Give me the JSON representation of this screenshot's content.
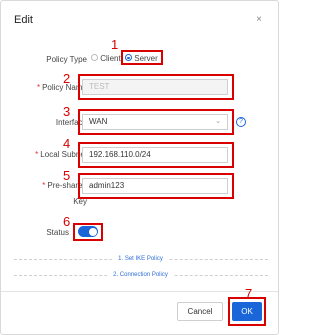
{
  "dialog": {
    "title": "Edit",
    "close_glyph": "×"
  },
  "annotations": [
    "1",
    "2",
    "3",
    "4",
    "5",
    "6",
    "7"
  ],
  "form": {
    "policy_type": {
      "label": "Policy Type",
      "options": [
        "Client",
        "Server"
      ],
      "selected": "Server"
    },
    "policy_name": {
      "label": "Policy Name",
      "value": "TEST",
      "required": true
    },
    "interface": {
      "label": "Interface",
      "value": "WAN",
      "help_glyph": "?"
    },
    "local_subnet": {
      "label": "Local Subnet",
      "value": "192.168.110.0/24",
      "required": true
    },
    "pre_shared_key": {
      "label_line1": "Pre-shared",
      "label_line2": "Key",
      "value": "admin123",
      "required": true
    },
    "status": {
      "label": "Status",
      "enabled": true
    }
  },
  "sections": {
    "ike_policy": "1. Set IKE Policy",
    "connection_policy": "2. Connection Policy"
  },
  "footer": {
    "cancel_label": "Cancel",
    "ok_label": "OK"
  },
  "colors": {
    "accent": "#1a66d9",
    "annotation": "#d90000"
  }
}
